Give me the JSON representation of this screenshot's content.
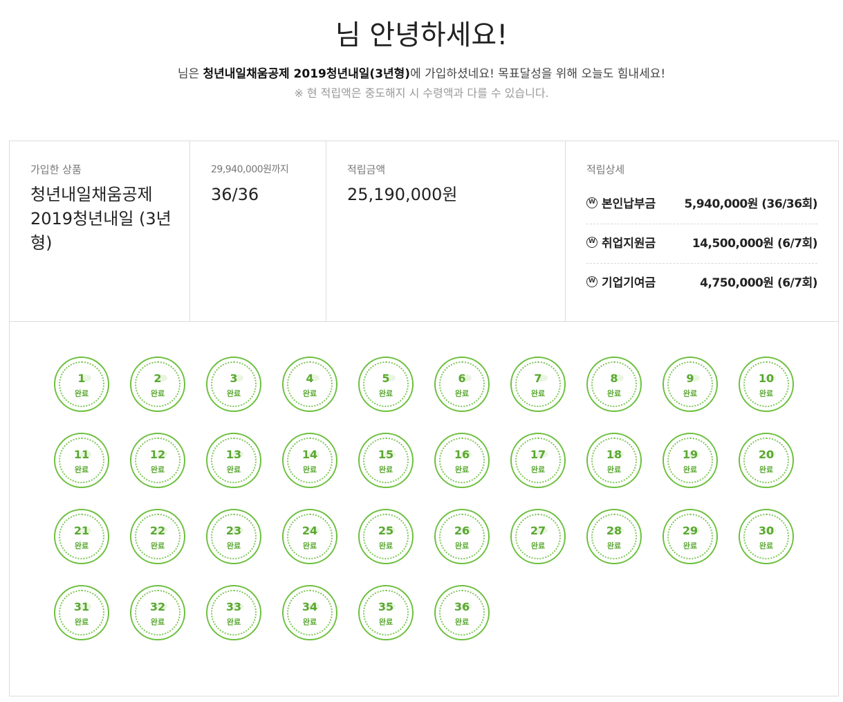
{
  "header": {
    "greeting": "님 안녕하세요!",
    "sub_prefix": "님은 ",
    "sub_product": "청년내일채움공제 2019청년내일(3년형)",
    "sub_suffix": "에 가입하셨네요! 목표달성을 위해 오늘도 힘내세요!",
    "notice": "※ 현 적립액은 중도해지 시 수령액과 다를 수 있습니다."
  },
  "summary": {
    "product_label": "가입한 상품",
    "product_name": "청년내일채움공제 2019청년내일 (3년형)",
    "target_label": "29,940,000원까지",
    "target_progress": "36/36",
    "amount_label": "적립금액",
    "amount_value": "25,190,000원",
    "detail_label": "적립상세",
    "details": [
      {
        "name": "본인납부금",
        "value": "5,940,000원 (36/36회)"
      },
      {
        "name": "취업지원금",
        "value": "14,500,000원 (6/7회)"
      },
      {
        "name": "기업기여금",
        "value": "4,750,000원 (6/7회)"
      }
    ],
    "won_icon_glyph": "W"
  },
  "stamps": {
    "status_label": "완료",
    "color": "#6cbf3e",
    "items": [
      "1",
      "2",
      "3",
      "4",
      "5",
      "6",
      "7",
      "8",
      "9",
      "10",
      "11",
      "12",
      "13",
      "14",
      "15",
      "16",
      "17",
      "18",
      "19",
      "20",
      "21",
      "22",
      "23",
      "24",
      "25",
      "26",
      "27",
      "28",
      "29",
      "30",
      "31",
      "32",
      "33",
      "34",
      "35",
      "36"
    ]
  }
}
